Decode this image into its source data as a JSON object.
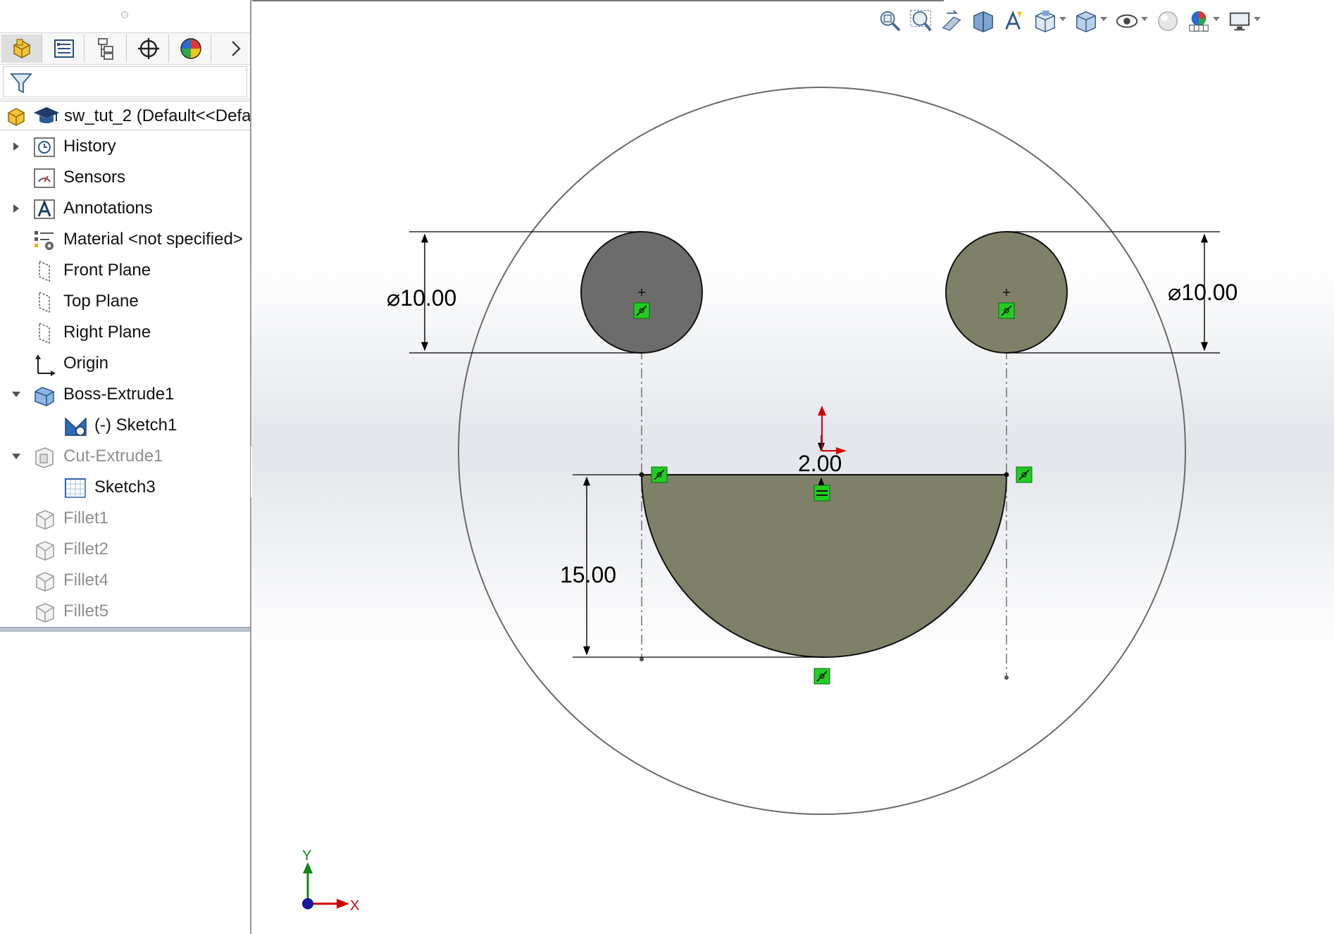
{
  "feature_tree": {
    "tabs": [
      {
        "name": "featuremanager",
        "icon": "part-tree-icon"
      },
      {
        "name": "propertymanager",
        "icon": "property-list-icon"
      },
      {
        "name": "configurationmanager",
        "icon": "configuration-icon"
      },
      {
        "name": "dimxpertmanager",
        "icon": "crosshair-target-icon"
      },
      {
        "name": "displaymanager",
        "icon": "appearance-sphere-icon"
      }
    ],
    "root": {
      "label": "sw_tut_2  (Default<<Defa"
    },
    "items": [
      {
        "label": "History",
        "icon": "history-icon",
        "expander": "collapsed",
        "suppressed": false
      },
      {
        "label": "Sensors",
        "icon": "sensors-icon",
        "expander": "none",
        "suppressed": false
      },
      {
        "label": "Annotations",
        "icon": "annotations-icon",
        "expander": "collapsed",
        "suppressed": false
      },
      {
        "label": "Material <not specified>",
        "icon": "material-icon",
        "expander": "none",
        "suppressed": false
      },
      {
        "label": "Front Plane",
        "icon": "plane-icon",
        "expander": "none",
        "suppressed": false
      },
      {
        "label": "Top Plane",
        "icon": "plane-icon",
        "expander": "none",
        "suppressed": false
      },
      {
        "label": "Right Plane",
        "icon": "plane-icon",
        "expander": "none",
        "suppressed": false
      },
      {
        "label": "Origin",
        "icon": "origin-icon",
        "expander": "none",
        "suppressed": false
      },
      {
        "label": "Boss-Extrude1",
        "icon": "boss-extrude-icon",
        "expander": "expanded",
        "suppressed": false
      },
      {
        "label": "(-) Sketch1",
        "icon": "sketch-icon",
        "expander": "none",
        "suppressed": false,
        "child": true
      },
      {
        "label": "Cut-Extrude1",
        "icon": "cut-extrude-icon",
        "expander": "expanded",
        "suppressed": true
      },
      {
        "label": "Sketch3",
        "icon": "sketch-grid-icon",
        "expander": "none",
        "suppressed": false,
        "child": true
      },
      {
        "label": "Fillet1",
        "icon": "fillet-icon",
        "expander": "none",
        "suppressed": true
      },
      {
        "label": "Fillet2",
        "icon": "fillet-icon",
        "expander": "none",
        "suppressed": true
      },
      {
        "label": "Fillet4",
        "icon": "fillet-icon",
        "expander": "none",
        "suppressed": true
      },
      {
        "label": "Fillet5",
        "icon": "fillet-icon",
        "expander": "none",
        "suppressed": true
      }
    ]
  },
  "heads_up_toolbar": [
    {
      "name": "zoom-to-fit-icon",
      "dropdown": false
    },
    {
      "name": "zoom-to-area-icon",
      "dropdown": false
    },
    {
      "name": "previous-view-icon",
      "dropdown": false
    },
    {
      "name": "section-view-icon",
      "dropdown": false
    },
    {
      "name": "dynamic-annotation-view-icon",
      "dropdown": false
    },
    {
      "name": "view-orientation-icon",
      "dropdown": true
    },
    {
      "name": "display-style-icon",
      "dropdown": true
    },
    {
      "name": "hide-show-items-icon",
      "dropdown": true
    },
    {
      "name": "edit-appearance-icon",
      "dropdown": false
    },
    {
      "name": "apply-scene-icon",
      "dropdown": true
    },
    {
      "name": "view-settings-icon",
      "dropdown": true
    }
  ],
  "sketch": {
    "dimensions": {
      "left_diameter": "⌀10.00",
      "right_diameter": "⌀10.00",
      "mouth_offset": "2.00",
      "mouth_depth": "15.00"
    },
    "triad": {
      "x_label": "X",
      "y_label": "Y"
    },
    "colors": {
      "sketch_fill": "#7f8068",
      "selected_fill": "#6c6c6c",
      "relation_marker": "#22cc22",
      "axis_x": "#cc0000",
      "axis_y": "#118811",
      "origin_dot": "#1a1aa0"
    }
  }
}
